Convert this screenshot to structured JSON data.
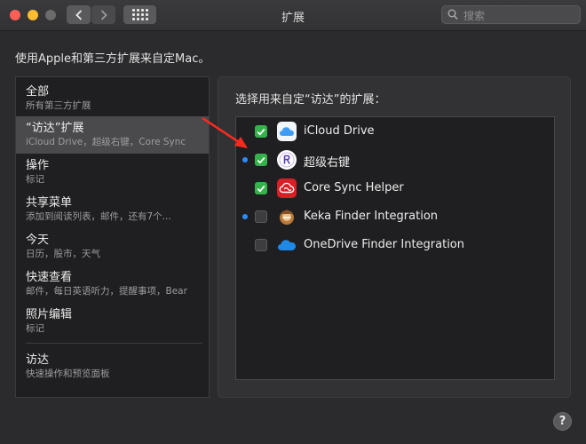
{
  "window": {
    "title": "扩展"
  },
  "search": {
    "placeholder": "搜索"
  },
  "description": "使用Apple和第三方扩展来自定Mac。",
  "sidebar": {
    "items": [
      {
        "title": "全部",
        "subtitle": "所有第三方扩展",
        "selected": false
      },
      {
        "title": "“访达”扩展",
        "subtitle": "iCloud Drive，超级右键，Core Sync",
        "selected": true
      },
      {
        "title": "操作",
        "subtitle": "标记",
        "selected": false
      },
      {
        "title": "共享菜单",
        "subtitle": "添加到阅读列表，邮件，还有7个...",
        "selected": false
      },
      {
        "title": "今天",
        "subtitle": "日历，股市，天气",
        "selected": false
      },
      {
        "title": "快速查看",
        "subtitle": "邮件，每日英语听力，提醒事项，Bear",
        "selected": false
      },
      {
        "title": "照片编辑",
        "subtitle": "标记",
        "selected": false
      },
      {
        "title": "访达",
        "subtitle": "快速操作和预览面板",
        "selected": false
      }
    ]
  },
  "panel": {
    "label": "选择用来自定“访达”的扩展：",
    "extensions": [
      {
        "name": "iCloud Drive",
        "checked": true,
        "new_dot": false,
        "icon": "icloud-icon"
      },
      {
        "name": "超级右键",
        "checked": true,
        "new_dot": true,
        "icon": "super-right-click-icon"
      },
      {
        "name": "Core Sync Helper",
        "checked": true,
        "new_dot": false,
        "icon": "adobe-creative-cloud-icon"
      },
      {
        "name": "Keka Finder Integration",
        "checked": false,
        "new_dot": true,
        "icon": "keka-icon"
      },
      {
        "name": "OneDrive Finder Integration",
        "checked": false,
        "new_dot": false,
        "icon": "onedrive-icon"
      }
    ]
  },
  "help": {
    "label": "?"
  },
  "colors": {
    "checkbox_on": "#34b34a",
    "new_dot": "#2d8cff",
    "arrow": "#ff2a1f"
  }
}
